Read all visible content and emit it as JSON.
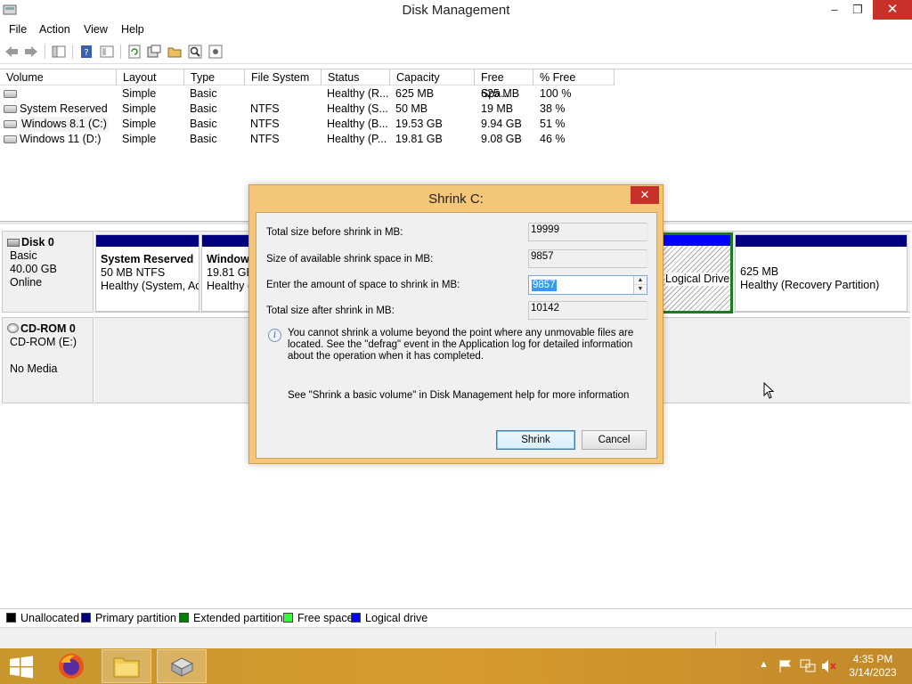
{
  "window": {
    "title": "Disk Management",
    "controls": {
      "minimize": "–",
      "maximize": "❐",
      "close": "✕"
    }
  },
  "menu": [
    "File",
    "Action",
    "View",
    "Help"
  ],
  "volume_table": {
    "columns": [
      "Volume",
      "Layout",
      "Type",
      "File System",
      "Status",
      "Capacity",
      "Free Spa...",
      "% Free"
    ],
    "rows": [
      [
        "",
        "Simple",
        "Basic",
        "",
        "Healthy (R...",
        "625 MB",
        "625 MB",
        "100 %"
      ],
      [
        "System Reserved",
        "Simple",
        "Basic",
        "NTFS",
        "Healthy (S...",
        "50 MB",
        "19 MB",
        "38 %"
      ],
      [
        "Windows 8.1 (C:)",
        "Simple",
        "Basic",
        "NTFS",
        "Healthy (B...",
        "19.53 GB",
        "9.94 GB",
        "51 %"
      ],
      [
        "Windows 11 (D:)",
        "Simple",
        "Basic",
        "NTFS",
        "Healthy (P...",
        "19.81 GB",
        "9.08 GB",
        "46 %"
      ]
    ]
  },
  "disks": {
    "disk0": {
      "name": "Disk 0",
      "type": "Basic",
      "size": "40.00 GB",
      "state": "Online",
      "partitions": {
        "system_reserved": {
          "name": "System Reserved",
          "size": "50 MB NTFS",
          "status": "Healthy (System, Ac"
        },
        "windows11": {
          "name": "Window",
          "size": "19.81 GB",
          "status": "Healthy ("
        },
        "logical": {
          "status": "Logical Drive)"
        },
        "recovery": {
          "size": "625 MB",
          "status": "Healthy (Recovery Partition)"
        }
      }
    },
    "cdrom0": {
      "name": "CD-ROM 0",
      "type": "CD-ROM (E:)",
      "state": "No Media"
    }
  },
  "legend": [
    {
      "label": "Unallocated",
      "color": "#000000"
    },
    {
      "label": "Primary partition",
      "color": "#00007f"
    },
    {
      "label": "Extended partition",
      "color": "#007f00"
    },
    {
      "label": "Free space",
      "color": "#33ff33"
    },
    {
      "label": "Logical drive",
      "color": "#0000ff"
    }
  ],
  "dialog": {
    "title": "Shrink C:",
    "close": "✕",
    "total_before_label": "Total size before shrink in MB:",
    "total_before_value": "19999",
    "available_label": "Size of available shrink space in MB:",
    "available_value": "9857",
    "amount_label": "Enter the amount of space to shrink in MB:",
    "amount_value": "9857",
    "total_after_label": "Total size after shrink in MB:",
    "total_after_value": "10142",
    "info_text": "You cannot shrink a volume beyond the point where any unmovable files are located. See the \"defrag\" event in the Application log for detailed information about the operation when it has completed.",
    "help_text": "See \"Shrink a basic volume\" in Disk Management help for more information",
    "shrink_button": "Shrink",
    "cancel_button": "Cancel"
  },
  "taskbar": {
    "time": "4:35 PM",
    "date": "3/14/2023"
  }
}
